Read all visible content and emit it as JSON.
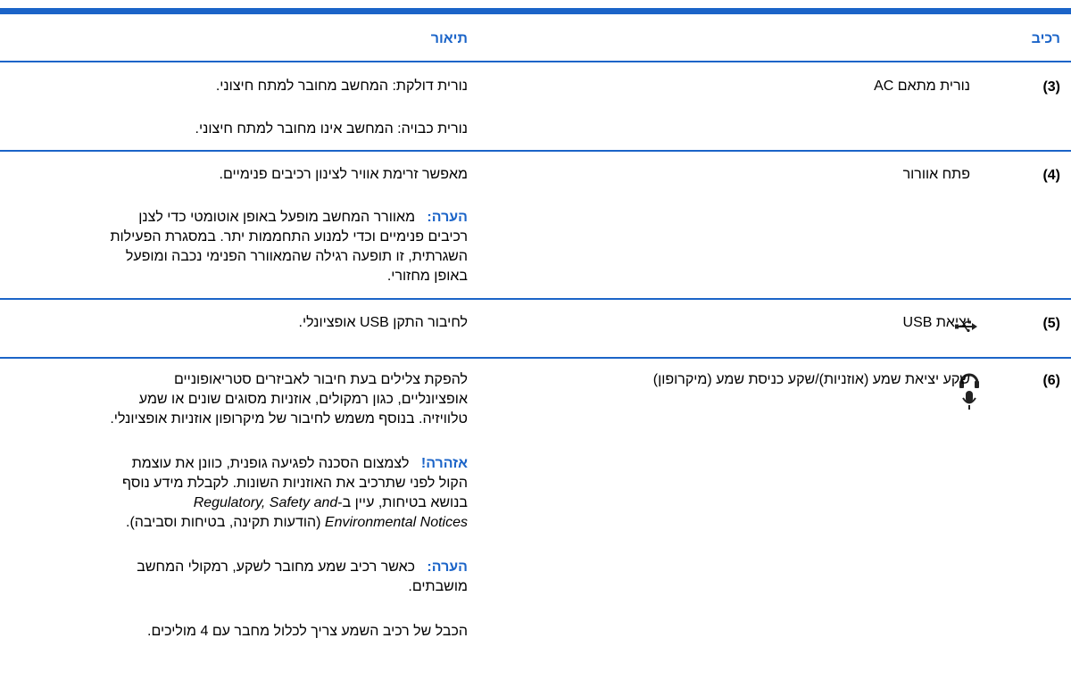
{
  "header": {
    "col_component": "רכיב",
    "col_description": "תיאור"
  },
  "rows": [
    {
      "number": "(3)",
      "component": "נורית מתאם AC",
      "desc": [
        "נורית דולקת: המחשב מחובר למתח חיצוני.",
        "נורית כבויה: המחשב אינו מחובר למתח חיצוני."
      ]
    },
    {
      "number": "(4)",
      "component": "פתח אוורור",
      "desc": [
        "מאפשר זרימת אוויר לצינון רכיבים פנימיים."
      ],
      "note_label": "הערה:",
      "note_line1": "מאוורר המחשב מופעל באופן אוטומטי כדי לצנן",
      "note_line2": "רכיבים פנימיים וכדי למנוע התחממות יתר. במסגרת הפעילות",
      "note_line3": "השגרתית, זו תופעה רגילה שהמאוורר הפנימי נכבה ומופעל",
      "note_line4": "באופן מחזורי."
    },
    {
      "number": "(5)",
      "component": "יציאת USB",
      "icon": "usb-icon",
      "desc": [
        "לחיבור התקן USB אופציונלי."
      ]
    },
    {
      "number": "(6)",
      "component": "שקע יציאת שמע (אוזניות)/שקע כניסת שמע (מיקרופון)",
      "icon": "headphone-microphone-icon",
      "desc": [
        "להפקת צלילים בעת חיבור לאביזרים סטריאופוניים",
        "אופציונליים, כגון רמקולים, אוזניות מסוגים שונים או שמע",
        "טלוויזיה. בנוסף משמש לחיבור של מיקרופון אוזניות אופציונלי."
      ],
      "warning_label": "אזהרה!",
      "warning_line1": "לצמצום הסכנה לפגיעה גופנית, כוונן את עוצמת",
      "warning_line2": "הקול לפני שתרכיב את האוזניות השונות. לקבלת מידע נוסף",
      "warning_line3": "בנושא בטיחות, עיין ב-",
      "warning_title1": "Regulatory, Safety and",
      "warning_title2": "Environmental Notices",
      "warning_line4": "(הודעות תקינה, בטיחות וסביבה).",
      "note_label": "הערה:",
      "note_line1": "כאשר רכיב שמע מחובר לשקע, רמקולי המחשב",
      "note_line2": "מושבתים.",
      "last_line": "הכבל של רכיב השמע צריך לכלול מחבר עם 4 מוליכים."
    }
  ],
  "colors": {
    "accent": "#1b64c8"
  }
}
